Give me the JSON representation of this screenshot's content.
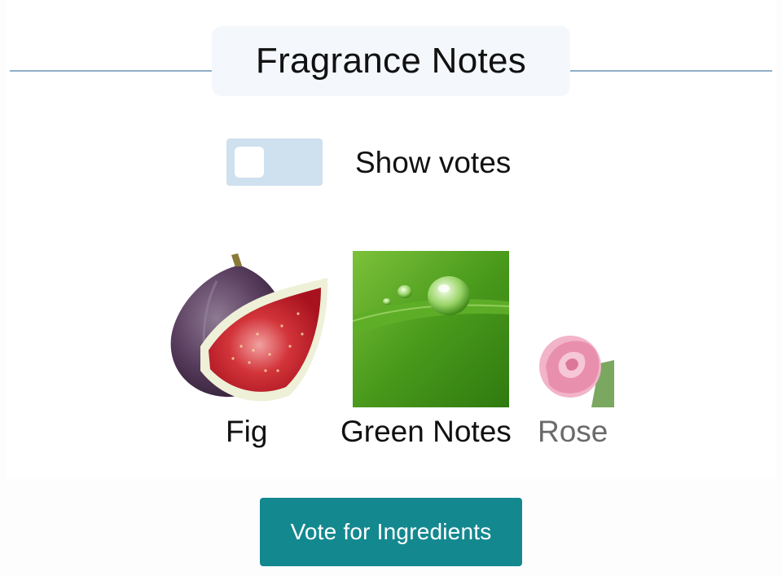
{
  "header": {
    "title": "Fragrance Notes"
  },
  "toggle": {
    "label": "Show votes",
    "checked": false,
    "track_color": "#cfe0ef"
  },
  "notes": [
    {
      "label": "Fig",
      "image": "fig-image"
    },
    {
      "label": "Green Notes",
      "image": "green-notes-image"
    },
    {
      "label": "Rose",
      "image": "rose-image"
    }
  ],
  "vote_button": {
    "label": "Vote for Ingredients",
    "color": "#14888f"
  }
}
